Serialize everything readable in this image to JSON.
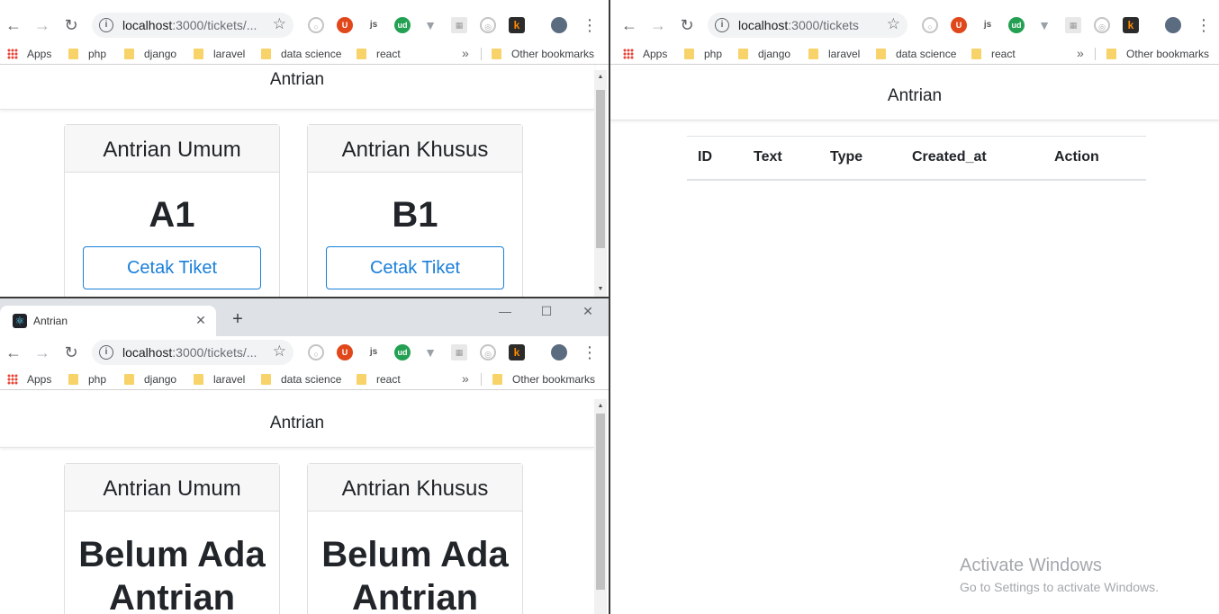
{
  "browser": {
    "tab_title": "Antrian",
    "favicon_icon": "react-icon",
    "new_tab_label": "+",
    "url_host_left": "localhost",
    "url_path_left": ":3000/tickets/...",
    "url_host_right": "localhost",
    "url_path_right": ":3000/tickets",
    "bookmarks": [
      {
        "label": "Apps"
      },
      {
        "label": "php"
      },
      {
        "label": "django"
      },
      {
        "label": "laravel"
      },
      {
        "label": "data science"
      },
      {
        "label": "react"
      }
    ],
    "more_bookmarks": "»",
    "other_bookmarks": "Other bookmarks"
  },
  "app": {
    "navbar_title": "Antrian",
    "cards": [
      {
        "header": "Antrian Umum",
        "number": "A1"
      },
      {
        "header": "Antrian Khusus",
        "number": "B1"
      }
    ],
    "button_label": "Cetak Tiket",
    "empty_line1": "Belum Ada",
    "empty_line2": "Antrian"
  },
  "table": {
    "columns": [
      "ID",
      "Text",
      "Type",
      "Created_at",
      "Action"
    ]
  },
  "watermark": {
    "title": "Activate Windows",
    "subtitle": "Go to Settings to activate Windows."
  },
  "colors": {
    "primary": "#1a7fd9",
    "chrome_frame": "#dee1e6"
  }
}
